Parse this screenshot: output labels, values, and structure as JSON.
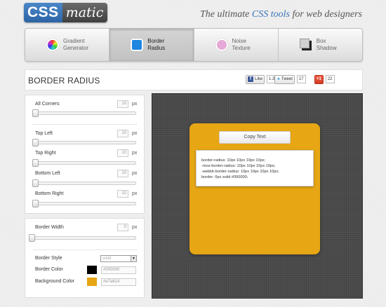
{
  "logo": {
    "part1": "CSS",
    "part2": "matic"
  },
  "tagline": {
    "prefix": "The ultimate ",
    "highlight": "CSS tools",
    "suffix": " for web designers"
  },
  "nav": {
    "tabs": [
      {
        "line1": "Gradient",
        "line2": "Generator",
        "icon": "gradient-icon",
        "active": false
      },
      {
        "line1": "Border",
        "line2": "Radius",
        "icon": "border-radius-icon",
        "active": true
      },
      {
        "line1": "Noise",
        "line2": "Texture",
        "icon": "noise-icon",
        "active": false
      },
      {
        "line1": "Box",
        "line2": "Shadow",
        "icon": "box-shadow-icon",
        "active": false
      }
    ]
  },
  "page_title": "BORDER RADIUS",
  "social": {
    "facebook": {
      "label": "Like",
      "count": "1.3k"
    },
    "twitter": {
      "label": "Tweet",
      "count": "17"
    },
    "google": {
      "label": "+1",
      "count": "22"
    }
  },
  "controls": {
    "all_corners": {
      "label": "All Corners",
      "value": "10",
      "unit": "px"
    },
    "top_left": {
      "label": "Top Left",
      "value": "10",
      "unit": "px"
    },
    "top_right": {
      "label": "Top Right",
      "value": "10",
      "unit": "px"
    },
    "bottom_left": {
      "label": "Bottom Left",
      "value": "10",
      "unit": "px"
    },
    "bottom_right": {
      "label": "Bottom Right",
      "value": "10",
      "unit": "px"
    },
    "border_width": {
      "label": "Border Width",
      "value": "0",
      "unit": "px"
    },
    "border_style": {
      "label": "Border Style",
      "value": "solid"
    },
    "border_color": {
      "label": "Border Color",
      "value": "#000000",
      "swatch": "#000000"
    },
    "background_color": {
      "label": "Background Color",
      "value": "#e7a614",
      "swatch": "#e7a614"
    }
  },
  "preview": {
    "copy_button": "Copy Text",
    "code_lines": [
      "border-radius: 10px 10px 10px 10px;",
      "-moz-border-radius: 10px 10px 10px 10px;",
      "-webkit-border-radius: 10px 10px 10px 10px;",
      "border: 0px solid #000000;"
    ]
  },
  "colors": {
    "accent_blue": "#3a74b8",
    "box_background": "#e7a614",
    "active_tab_icon": "#1c86e0"
  }
}
